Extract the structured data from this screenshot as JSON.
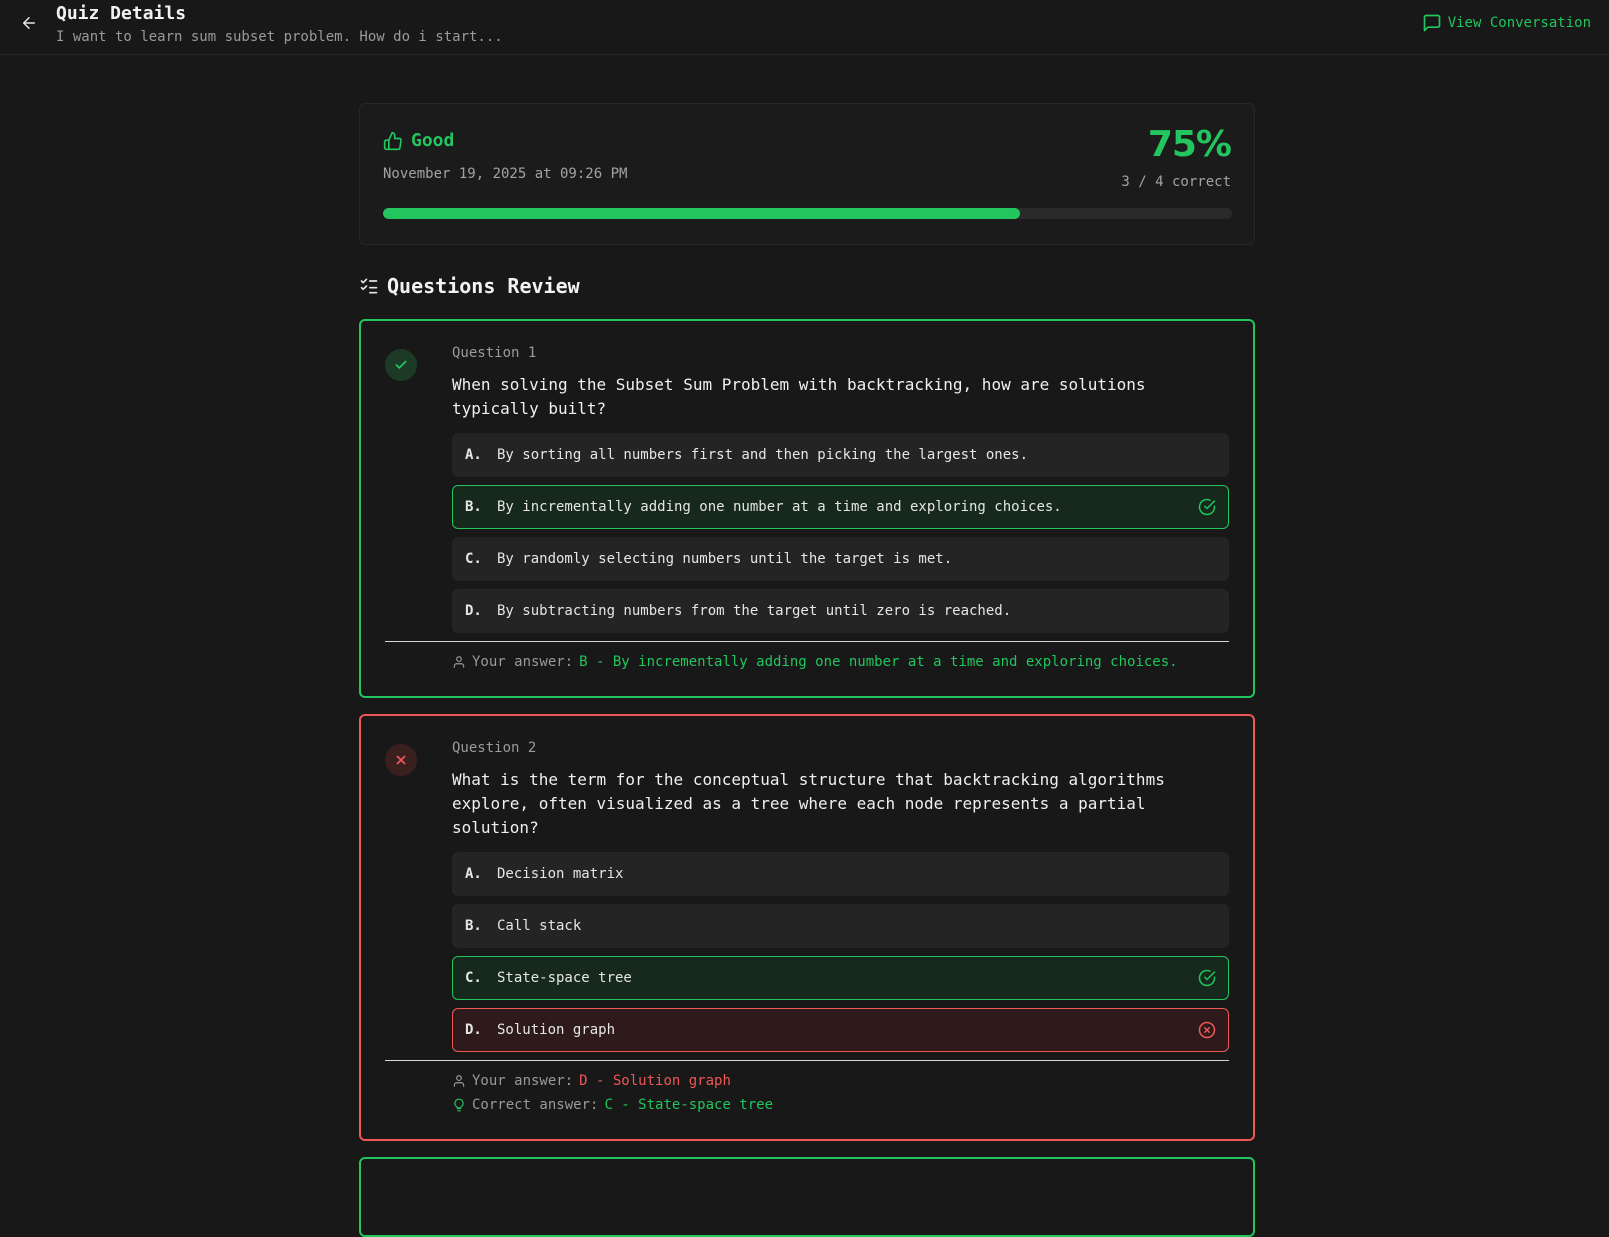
{
  "header": {
    "title": "Quiz Details",
    "subtitle": "I want to learn sum subset problem. How do i start...",
    "view_conversation": "View Conversation"
  },
  "score": {
    "label": "Good",
    "date": "November 19, 2025 at 09:26 PM",
    "percent": "75%",
    "count": "3 / 4 correct",
    "progress_fraction": 0.75
  },
  "section": {
    "title": "Questions Review"
  },
  "questions": [
    {
      "number": "Question 1",
      "status": "correct",
      "text": "When solving the Subset Sum Problem with backtracking, how are solutions typically built?",
      "options": [
        {
          "letter": "A.",
          "text": "By sorting all numbers first and then picking the largest ones.",
          "state": "none"
        },
        {
          "letter": "B.",
          "text": "By incrementally adding one number at a time and exploring choices.",
          "state": "correct"
        },
        {
          "letter": "C.",
          "text": "By randomly selecting numbers until the target is met.",
          "state": "none"
        },
        {
          "letter": "D.",
          "text": "By subtracting numbers from the target until zero is reached.",
          "state": "none"
        }
      ],
      "your_answer_label": "Your answer:",
      "your_answer": "B - By incrementally adding one number at a time and exploring choices."
    },
    {
      "number": "Question 2",
      "status": "wrong",
      "text": "What is the term for the conceptual structure that backtracking algorithms explore, often visualized as a tree where each node represents a partial solution?",
      "options": [
        {
          "letter": "A.",
          "text": "Decision matrix",
          "state": "none"
        },
        {
          "letter": "B.",
          "text": "Call stack",
          "state": "none"
        },
        {
          "letter": "C.",
          "text": "State-space tree",
          "state": "correct"
        },
        {
          "letter": "D.",
          "text": "Solution graph",
          "state": "incorrect"
        }
      ],
      "your_answer_label": "Your answer:",
      "your_answer": "D - Solution graph",
      "correct_answer_label": "Correct answer:",
      "correct_answer": "C - State-space tree"
    }
  ],
  "colors": {
    "accent": "#22c55e",
    "error": "#ef5757",
    "background": "#181818"
  }
}
